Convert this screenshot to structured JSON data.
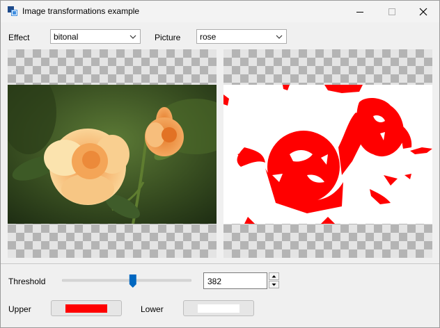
{
  "window": {
    "title": "Image transformations example"
  },
  "controls": {
    "effect_label": "Effect",
    "effect_value": "bitonal",
    "picture_label": "Picture",
    "picture_value": "rose",
    "threshold_label": "Threshold",
    "threshold_value": "382",
    "threshold_slider_fraction": 0.55,
    "upper_label": "Upper",
    "upper_color": "#ff0000",
    "lower_label": "Lower",
    "lower_color": "#ffffff"
  },
  "icons": {
    "app": "app-window-icon",
    "minimize": "minimize-icon",
    "maximize": "maximize-icon",
    "close": "close-icon",
    "dropdown": "chevron-down-icon",
    "spin_up": "spin-up-icon",
    "spin_down": "spin-down-icon"
  }
}
